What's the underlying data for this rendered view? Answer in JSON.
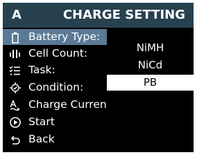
{
  "header": {
    "letter": "A",
    "title": "CHARGE SETTING"
  },
  "menu": {
    "items": [
      {
        "label": "Battery Type:",
        "icon": "battery-icon",
        "selected": true
      },
      {
        "label": "Cell Count:",
        "icon": "cell-count-icon",
        "selected": false
      },
      {
        "label": "Task:",
        "icon": "task-list-icon",
        "selected": false
      },
      {
        "label": "Condition:",
        "icon": "condition-icon",
        "selected": false
      },
      {
        "label": "Charge Current",
        "icon": "charge-current-icon",
        "selected": false
      },
      {
        "label": "Start",
        "icon": "play-icon",
        "selected": false
      },
      {
        "label": "Back",
        "icon": "back-arrow-icon",
        "selected": false
      }
    ]
  },
  "dropdown": {
    "options": [
      "NiMH",
      "NiCd",
      "PB"
    ],
    "highlighted": "PB"
  },
  "colors": {
    "header_bg": "#27414f",
    "selected_bg": "#5a7a96",
    "screen_bg": "#000000",
    "highlight_bg": "#ffffff"
  }
}
